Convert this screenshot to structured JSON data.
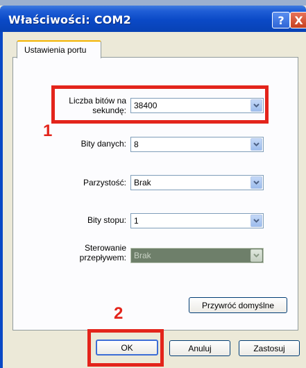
{
  "window": {
    "title": "Właściwości: COM2",
    "help_label": "?",
    "close_label": "X"
  },
  "tabs": [
    {
      "label": "Ustawienia portu"
    }
  ],
  "fields": {
    "bits_per_second": {
      "label": "Liczba bitów na sekundę:",
      "value": "38400"
    },
    "data_bits": {
      "label": "Bity danych:",
      "value": "8"
    },
    "parity": {
      "label": "Parzystość:",
      "value": "Brak"
    },
    "stop_bits": {
      "label": "Bity stopu:",
      "value": "1"
    },
    "flow_control": {
      "label": "Sterowanie przepływem:",
      "value": "Brak"
    }
  },
  "buttons": {
    "restore_defaults": "Przywróć domyślne",
    "ok": "OK",
    "cancel": "Anuluj",
    "apply": "Zastosuj"
  },
  "annotations": {
    "marker_1": "1",
    "marker_2": "2"
  },
  "colors": {
    "annotation_red": "#e3241b",
    "titlebar_blue": "#0a49c6"
  },
  "icons": {
    "combo_arrow": "chevron-down-icon"
  }
}
